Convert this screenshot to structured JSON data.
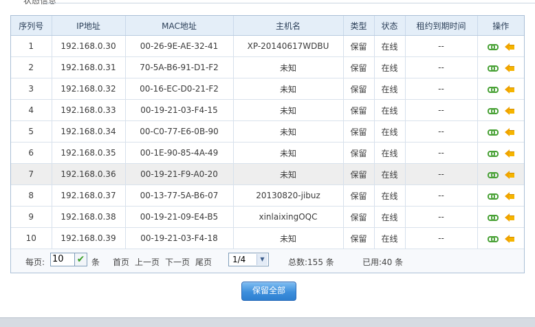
{
  "header": {
    "cut_title": "状态信息"
  },
  "table": {
    "columns": {
      "seq": "序列号",
      "ip": "IP地址",
      "mac": "MAC地址",
      "host": "主机名",
      "type": "类型",
      "status": "状态",
      "expire": "租约到期时间",
      "ops": "操作"
    },
    "rows": [
      {
        "seq": "1",
        "ip": "192.168.0.30",
        "mac": "00-26-9E-AE-32-41",
        "host": "XP-20140617WDBU",
        "type": "保留",
        "status": "在线",
        "expire": "--"
      },
      {
        "seq": "2",
        "ip": "192.168.0.31",
        "mac": "70-5A-B6-91-D1-F2",
        "host": "未知",
        "type": "保留",
        "status": "在线",
        "expire": "--"
      },
      {
        "seq": "3",
        "ip": "192.168.0.32",
        "mac": "00-16-EC-D0-21-F2",
        "host": "未知",
        "type": "保留",
        "status": "在线",
        "expire": "--"
      },
      {
        "seq": "4",
        "ip": "192.168.0.33",
        "mac": "00-19-21-03-F4-15",
        "host": "未知",
        "type": "保留",
        "status": "在线",
        "expire": "--"
      },
      {
        "seq": "5",
        "ip": "192.168.0.34",
        "mac": "00-C0-77-E6-0B-90",
        "host": "未知",
        "type": "保留",
        "status": "在线",
        "expire": "--"
      },
      {
        "seq": "6",
        "ip": "192.168.0.35",
        "mac": "00-1E-90-85-4A-49",
        "host": "未知",
        "type": "保留",
        "status": "在线",
        "expire": "--"
      },
      {
        "seq": "7",
        "ip": "192.168.0.36",
        "mac": "00-19-21-F9-A0-20",
        "host": "未知",
        "type": "保留",
        "status": "在线",
        "expire": "--"
      },
      {
        "seq": "8",
        "ip": "192.168.0.37",
        "mac": "00-13-77-5A-B6-07",
        "host": "20130820-jibuz",
        "type": "保留",
        "status": "在线",
        "expire": "--"
      },
      {
        "seq": "9",
        "ip": "192.168.0.38",
        "mac": "00-19-21-09-E4-B5",
        "host": "xinlaixingOQC",
        "type": "保留",
        "status": "在线",
        "expire": "--"
      },
      {
        "seq": "10",
        "ip": "192.168.0.39",
        "mac": "00-19-21-03-F4-18",
        "host": "未知",
        "type": "保留",
        "status": "在线",
        "expire": "--"
      }
    ],
    "hover_row": 7,
    "icons": {
      "bind": "link-icon",
      "release": "arrow-left-icon"
    }
  },
  "pager": {
    "per_page_label": "每页:",
    "per_page_value": "10",
    "unit": "条",
    "first": "首页",
    "prev": "上一页",
    "next": "下一页",
    "last": "尾页",
    "page_value": "1/4",
    "total": "总数:155 条",
    "used": "已用:40 条"
  },
  "actions": {
    "reserve_all": "保留全部"
  },
  "colors": {
    "header_bg": "#e4eef8",
    "border": "#a9bfd6",
    "button_blue": "#3d8fdc",
    "link_green": "#46a033",
    "arrow_orange": "#f0a300"
  }
}
